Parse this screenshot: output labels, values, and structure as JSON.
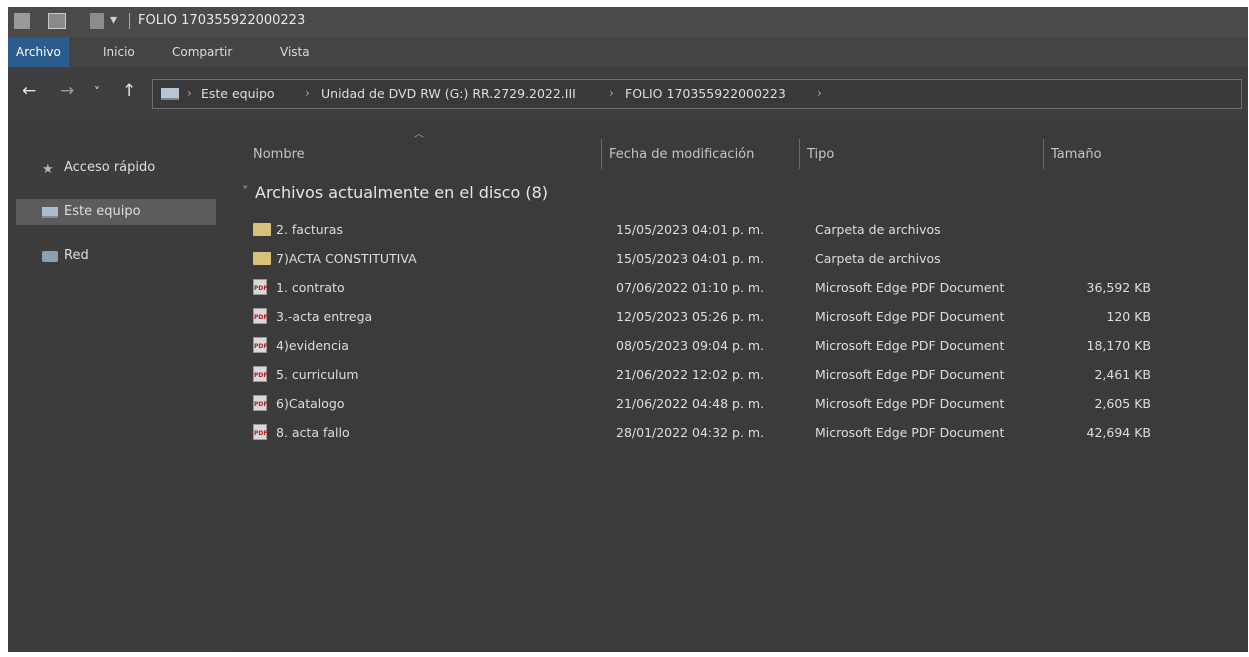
{
  "window": {
    "title": "FOLIO 170355922000223"
  },
  "ribbon": {
    "tabs": [
      "Archivo",
      "Inicio",
      "Compartir",
      "Vista"
    ]
  },
  "nav": {
    "back": "←",
    "forward": "→",
    "recent": "˅",
    "up": "↑",
    "separator": "›"
  },
  "address": {
    "crumbs": [
      "Este equipo",
      "Unidad de DVD RW (G:) RR.2729.2022.III",
      "FOLIO 170355922000223"
    ]
  },
  "sidebar": {
    "items": [
      {
        "label": "Acceso rápido",
        "icon": "star-icon"
      },
      {
        "label": "Este equipo",
        "icon": "computer-icon"
      },
      {
        "label": "Red",
        "icon": "network-icon"
      }
    ]
  },
  "columns": {
    "name": "Nombre",
    "modified": "Fecha de modificación",
    "type": "Tipo",
    "size": "Tamaño"
  },
  "group": {
    "title": "Archivos actualmente en el disco (8)"
  },
  "files": [
    {
      "name": "2. facturas",
      "modified": "15/05/2023 04:01 p. m.",
      "type": "Carpeta de archivos",
      "size": "",
      "icon": "folder-icon"
    },
    {
      "name": "7)ACTA CONSTITUTIVA",
      "modified": "15/05/2023 04:01 p. m.",
      "type": "Carpeta de archivos",
      "size": "",
      "icon": "folder-icon"
    },
    {
      "name": "1. contrato",
      "modified": "07/06/2022 01:10 p. m.",
      "type": "Microsoft Edge PDF Document",
      "size": "36,592 KB",
      "icon": "pdf-icon"
    },
    {
      "name": "3.-acta entrega",
      "modified": "12/05/2023 05:26 p. m.",
      "type": "Microsoft Edge PDF Document",
      "size": "120 KB",
      "icon": "pdf-icon"
    },
    {
      "name": "4)evidencia",
      "modified": "08/05/2023 09:04 p. m.",
      "type": "Microsoft Edge PDF Document",
      "size": "18,170 KB",
      "icon": "pdf-icon"
    },
    {
      "name": "5. curriculum",
      "modified": "21/06/2022 12:02 p. m.",
      "type": "Microsoft Edge PDF Document",
      "size": "2,461 KB",
      "icon": "pdf-icon"
    },
    {
      "name": "6)Catalogo",
      "modified": "21/06/2022 04:48 p. m.",
      "type": "Microsoft Edge PDF Document",
      "size": "2,605 KB",
      "icon": "pdf-icon"
    },
    {
      "name": "8. acta fallo",
      "modified": "28/01/2022 04:32 p. m.",
      "type": "Microsoft Edge PDF Document",
      "size": "42,694 KB",
      "icon": "pdf-icon"
    }
  ],
  "icons": {
    "pdf_glyph": "PDF"
  }
}
